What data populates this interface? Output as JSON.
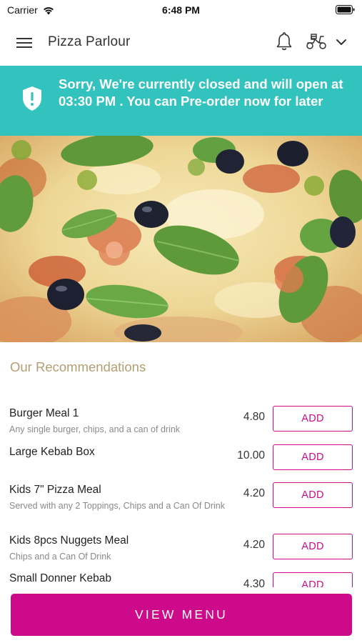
{
  "status_bar": {
    "carrier": "Carrier",
    "time": "6:48 PM",
    "icons": [
      "wifi-icon",
      "battery-icon"
    ]
  },
  "header": {
    "title": "Pizza Parlour",
    "icons": [
      "hamburger-menu-icon",
      "bell-icon",
      "scooter-icon",
      "chevron-down-icon"
    ]
  },
  "banner": {
    "message": "Sorry, We're currently closed and will open at 03:30 PM . You can Pre-order now for later",
    "icon": "shield-alert-icon",
    "background": "#33c3bf"
  },
  "hero": {
    "description": "pizza-photo"
  },
  "recommendations": {
    "title": "Our Recommendations",
    "items": [
      {
        "name": "Burger Meal 1",
        "description": "Any single burger, chips, and a can of drink",
        "price": "4.80",
        "action": "ADD"
      },
      {
        "name": "Large Kebab Box",
        "description": "",
        "price": "10.00",
        "action": "ADD"
      },
      {
        "name": "Kids 7\" Pizza Meal",
        "description": "Served with any 2 Toppings, Chips and a Can Of Drink",
        "price": "4.20",
        "action": "ADD"
      },
      {
        "name": "Kids 8pcs Nuggets Meal",
        "description": "Chips and a Can Of Drink",
        "price": "4.20",
        "action": "ADD"
      },
      {
        "name": "Small Donner Kebab",
        "description": "",
        "price": "4.30",
        "action": "ADD"
      }
    ]
  },
  "cta": {
    "label": "VIEW MENU"
  },
  "colors": {
    "accent": "#cc0a8a",
    "banner": "#33c3bf",
    "section_title": "#b39e72"
  }
}
